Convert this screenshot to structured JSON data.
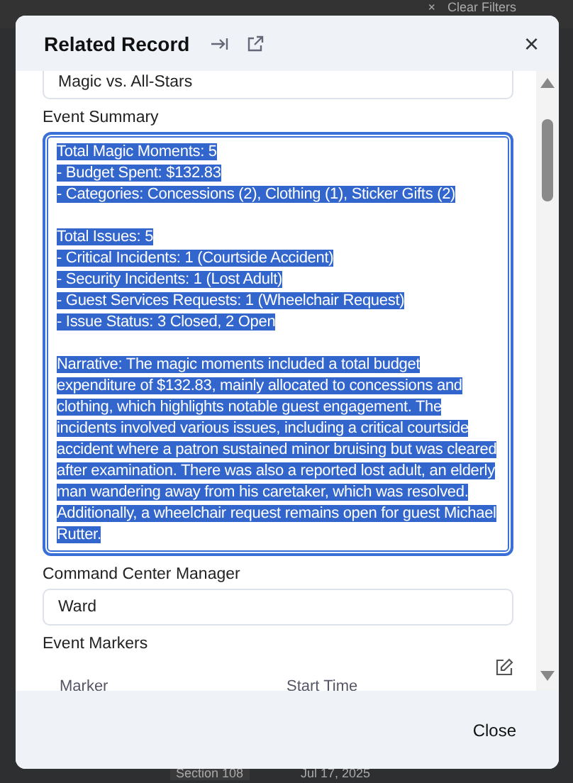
{
  "background": {
    "filter_button": {
      "icon": "×",
      "label": "Clear Filters"
    },
    "cells": [
      "Section 108",
      "Jul 17, 2025"
    ]
  },
  "modal": {
    "title": "Related Record",
    "close_icon": "×",
    "fields": [
      {
        "kind": "input",
        "value": "Magic vs. All-Stars"
      },
      {
        "kind": "textarea",
        "label": "Event Summary",
        "focused": true,
        "selected": true,
        "paragraphs": [
          [
            "Total Magic Moments: 5",
            "- Budget Spent: $132.83",
            "- Categories: Concessions (2), Clothing (1), Sticker Gifts (2)"
          ],
          [
            "Total Issues: 5",
            "- Critical Incidents: 1 (Courtside Accident)",
            "- Security Incidents: 1 (Lost Adult)",
            "- Guest Services Requests: 1 (Wheelchair Request)",
            "- Issue Status: 3 Closed, 2 Open"
          ],
          [
            "Narrative: The magic moments included a total budget expenditure of $132.83, mainly allocated to concessions and clothing, which highlights notable guest engagement. The incidents involved various issues, including a critical courtside accident where a patron sustained minor bruising but was cleared after examination. There was also a reported lost adult, an elderly man wandering away from his caretaker, which was resolved. Additionally, a wheelchair request remains open for guest Michael Rutter."
          ]
        ]
      },
      {
        "kind": "input",
        "label": "Command Center Manager",
        "value": "Ward"
      },
      {
        "kind": "table",
        "label": "Event Markers",
        "columns": [
          "Marker",
          "Start Time"
        ]
      }
    ],
    "footer_button": "Close"
  }
}
